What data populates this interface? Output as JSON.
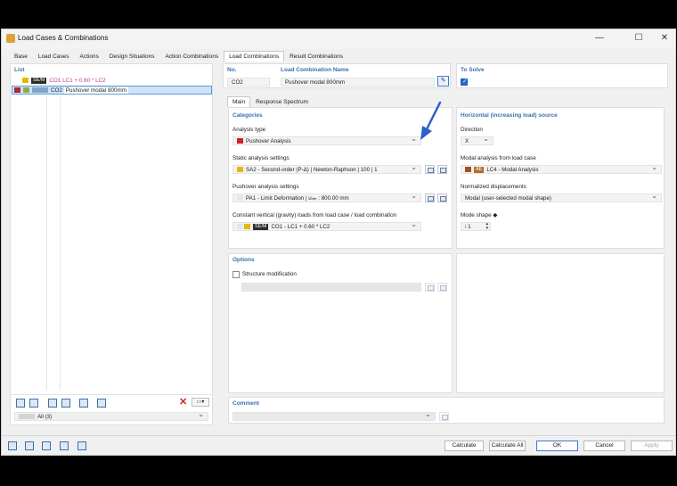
{
  "window": {
    "title": "Load Cases & Combinations"
  },
  "tabs": [
    {
      "label": "Base"
    },
    {
      "label": "Load Cases"
    },
    {
      "label": "Actions"
    },
    {
      "label": "Design Situations"
    },
    {
      "label": "Action Combinations"
    },
    {
      "label": "Load Combinations",
      "active": true
    },
    {
      "label": "Result Combinations"
    }
  ],
  "list": {
    "header": "List",
    "rows": [
      {
        "tag": "SE/M",
        "id": "CO1",
        "name": "LC1 + 0.60 * LC2",
        "name_color": "#c0399a"
      },
      {
        "id": "CO2",
        "name": "Pushover modal 800mm",
        "selected": true
      }
    ],
    "filter": "All (3)"
  },
  "no": {
    "label": "No.",
    "value": "CO2"
  },
  "name": {
    "label": "Load Combination Name",
    "value": "Pushover modal 800mm"
  },
  "to_solve": {
    "label": "To Solve",
    "checked": true
  },
  "subtabs": [
    {
      "label": "Main",
      "active": true
    },
    {
      "label": "Response Spectrum"
    }
  ],
  "categories": {
    "header": "Categories",
    "analysis_type": {
      "label": "Analysis type",
      "value": "Pushover Analysis",
      "color": "#d0202a"
    },
    "static": {
      "label": "Static analysis settings",
      "value": "SA2 - Second-order (P-Δ) | Newton-Raphson | 100 | 1",
      "color": "#e8b800"
    },
    "pushover": {
      "label": "Pushover analysis settings",
      "value": "PA1 - Limit Deformation | uₗᵢₘ : 800.00 mm"
    },
    "constant": {
      "label": "Constant vertical (gravity) loads from load case / load combination",
      "tag": "SE/M",
      "value": "CO1 - LC1 + 0.60 * LC2",
      "color": "#e8b800"
    }
  },
  "horizontal": {
    "header": "Horizontal (increasing load) source",
    "direction": {
      "label": "Direction",
      "value": "X"
    },
    "modal": {
      "label": "Modal analysis from load case",
      "tag": "AE",
      "value": "LC4 - Modal Analysis",
      "color": "#a0521d"
    },
    "normalized": {
      "label": "Normalized displacements",
      "value": "Modal (user-selected modal shape)"
    },
    "mode_shape": {
      "label": "Mode shape ◆",
      "prefix": "i",
      "value": "1"
    }
  },
  "options": {
    "header": "Options",
    "structure_mod": "Structure modification"
  },
  "comment": {
    "header": "Comment"
  },
  "buttons": {
    "calculate": "Calculate",
    "calculate_all": "Calculate All",
    "ok": "OK",
    "cancel": "Cancel",
    "apply": "Apply"
  },
  "colors": {
    "accent": "#3b6fb0",
    "selection": "#cfe3f7",
    "arrow": "#2f5fc9"
  }
}
